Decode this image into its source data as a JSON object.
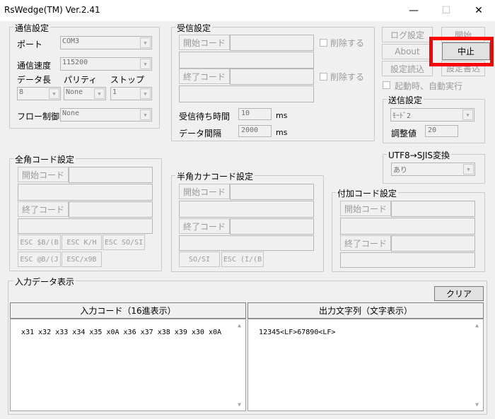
{
  "window": {
    "title": "RsWedge(TM) Ver.2.41",
    "minimize": "—",
    "maximize": "☐",
    "close": "✕"
  },
  "comm": {
    "legend": "通信設定",
    "port_label": "ポート",
    "port_value": "COM3",
    "speed_label": "通信速度",
    "speed_value": "115200",
    "data_len_label": "データ長",
    "parity_label": "パリティ",
    "stop_label": "ストップ",
    "data_len_value": "8",
    "parity_value": "None",
    "stop_value": "1",
    "flow_label": "フロー制御",
    "flow_value": "None"
  },
  "receive": {
    "legend": "受信設定",
    "start_code_btn": "開始コード",
    "end_code_btn": "終了コード",
    "delete_label": "削除する",
    "wait_label": "受信待ち時間",
    "wait_value": "10",
    "wait_unit": "ms",
    "interval_label": "データ間隔",
    "interval_value": "2000",
    "interval_unit": "ms"
  },
  "right": {
    "log_settings": "ログ設定",
    "start": "開始",
    "about": "About",
    "stop": "中止",
    "load_settings": "設定読込",
    "save_settings": "設定書込",
    "autorun_label": "起動時、自動実行",
    "send_legend": "送信設定",
    "send_mode": "ﾓｰﾄﾞ2",
    "adjust_label": "調整値",
    "adjust_value": "20",
    "utf8_legend": "UTF8→SJIS変換",
    "utf8_value": "あり"
  },
  "fullwidth": {
    "legend": "全角コード設定",
    "start_code_btn": "開始コード",
    "end_code_btn": "終了コード",
    "esc_b_b": "ESC $B/(B",
    "esc_kh": "ESC K/H",
    "esc_so_si": "ESC SO/SI",
    "esc_b_j": "ESC @B/(J",
    "esc_x9b": "ESC/x9B"
  },
  "halfkana": {
    "legend": "半角カナコード設定",
    "start_code_btn": "開始コード",
    "end_code_btn": "終了コード",
    "so_si": "SO/SI",
    "esc_i_b": "ESC (I/(B"
  },
  "addcode": {
    "legend": "付加コード設定",
    "start_code_btn": "開始コード",
    "end_code_btn": "終了コード"
  },
  "input_display": {
    "legend": "入力データ表示",
    "clear_btn": "クリア",
    "input_header": "入力コード（16進表示）",
    "output_header": "出力文字列（文字表示）",
    "input_text": "x31 x32 x33 x34 x35 x0A x36 x37 x38 x39 x30 x0A",
    "output_text": "12345<LF>67890<LF>"
  },
  "colors": {
    "highlight": "#ff0000",
    "background": "#f0f0f0"
  }
}
